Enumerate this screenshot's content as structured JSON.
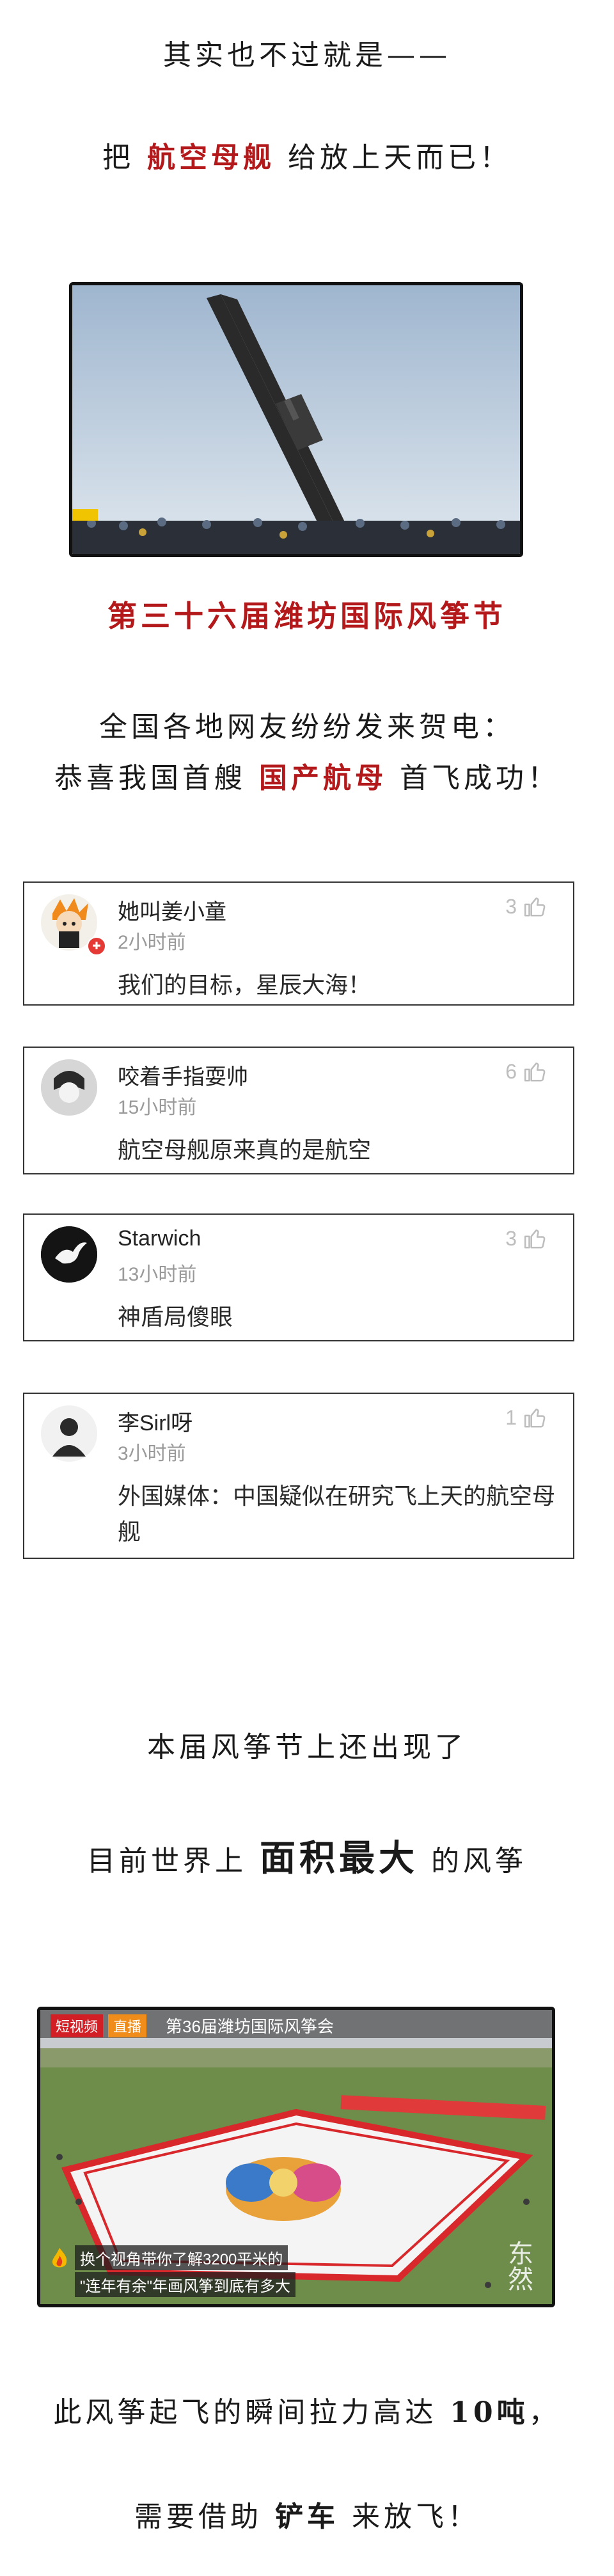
{
  "intro": {
    "line1": "其实也不过就是——",
    "line2_pre": "把",
    "line2_red": "航空母舰",
    "line2_post": "给放上天而已！"
  },
  "event_title": "第三十六届潍坊国际风筝节",
  "congrats": {
    "line1": "全国各地网友纷纷发来贺电：",
    "line2_pre": "恭喜我国首艘",
    "line2_red": "国产航母",
    "line2_post": "首飞成功！"
  },
  "comments": [
    {
      "user": "她叫姜小童",
      "time": "2小时前",
      "likes": "3",
      "text": "我们的目标，星辰大海！"
    },
    {
      "user": "咬着手指耍帅",
      "time": "15小时前",
      "likes": "6",
      "text": "航空母舰原来真的是航空"
    },
    {
      "user": "Starwich",
      "time": "13小时前",
      "likes": "3",
      "text": "神盾局傻眼"
    },
    {
      "user": "李Sirl呀",
      "time": "3小时前",
      "likes": "1",
      "text": "外国媒体：中国疑似在研究飞上天的航空母舰"
    }
  ],
  "section2": {
    "line1": "本届风筝节上还出现了",
    "line2_pre": "目前世界上",
    "line2_bold": "面积最大",
    "line2_post": "的风筝"
  },
  "video": {
    "tag1": "短视频",
    "tag2": "直播",
    "channel_title": "第36届潍坊国际风筝会",
    "caption1": "换个视角带你了解3200平米的",
    "caption2": "\"连年有余\"年画风筝到底有多大",
    "watermark": "东然"
  },
  "closing": {
    "line1_pre": "此风筝起飞的瞬间拉力高达",
    "line1_bold": "10吨",
    "line1_post": "，",
    "line2_pre": "需要借助",
    "line2_bold": "铲车",
    "line2_post": "来放飞！"
  }
}
